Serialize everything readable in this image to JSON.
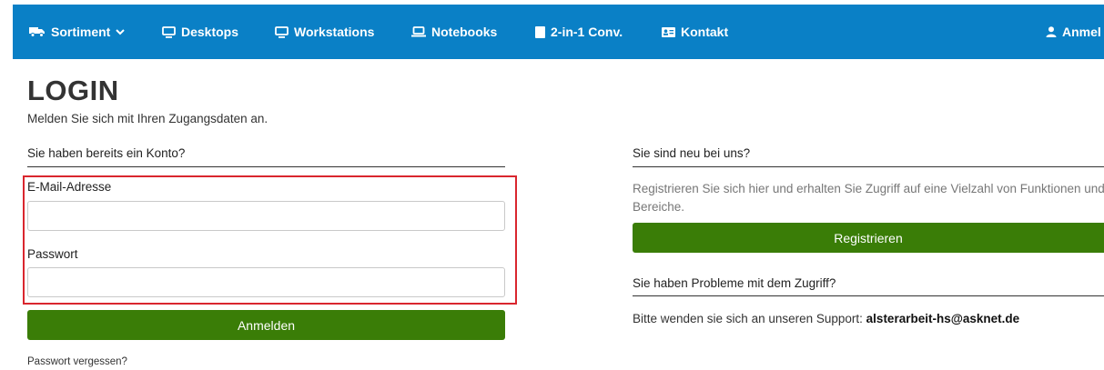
{
  "nav": {
    "sortiment": "Sortiment",
    "desktops": "Desktops",
    "workstations": "Workstations",
    "notebooks": "Notebooks",
    "convertibles": "2-in-1 Conv.",
    "kontakt": "Kontakt",
    "login": "Anmel"
  },
  "page": {
    "title": "LOGIN",
    "subtitle": "Melden Sie sich mit Ihren Zugangsdaten an."
  },
  "login_form": {
    "heading": "Sie haben bereits ein Konto?",
    "email_label": "E-Mail-Adresse",
    "email_value": "",
    "password_label": "Passwort",
    "password_value": "",
    "submit_label": "Anmelden",
    "forgot_label": "Passwort vergessen?"
  },
  "register": {
    "heading": "Sie sind neu bei uns?",
    "text": "Registrieren Sie sich hier und erhalten Sie Zugriff auf eine Vielzahl von Funktionen und Bereiche.",
    "button_label": "Registrieren"
  },
  "support": {
    "heading": "Sie haben Probleme mit dem Zugriff?",
    "text": "Bitte wenden sie sich an unseren Support: ",
    "email": "alsterarbeit-hs@asknet.de"
  },
  "colors": {
    "navbar": "#0a80c6",
    "button": "#3a7d07",
    "highlight": "#d9262e"
  },
  "icons": {
    "sortiment": "truck-icon",
    "desktops": "monitor-icon",
    "workstations": "monitor-icon",
    "notebooks": "laptop-icon",
    "convertibles": "tablet-icon",
    "kontakt": "contact-card-icon",
    "login": "user-icon"
  }
}
